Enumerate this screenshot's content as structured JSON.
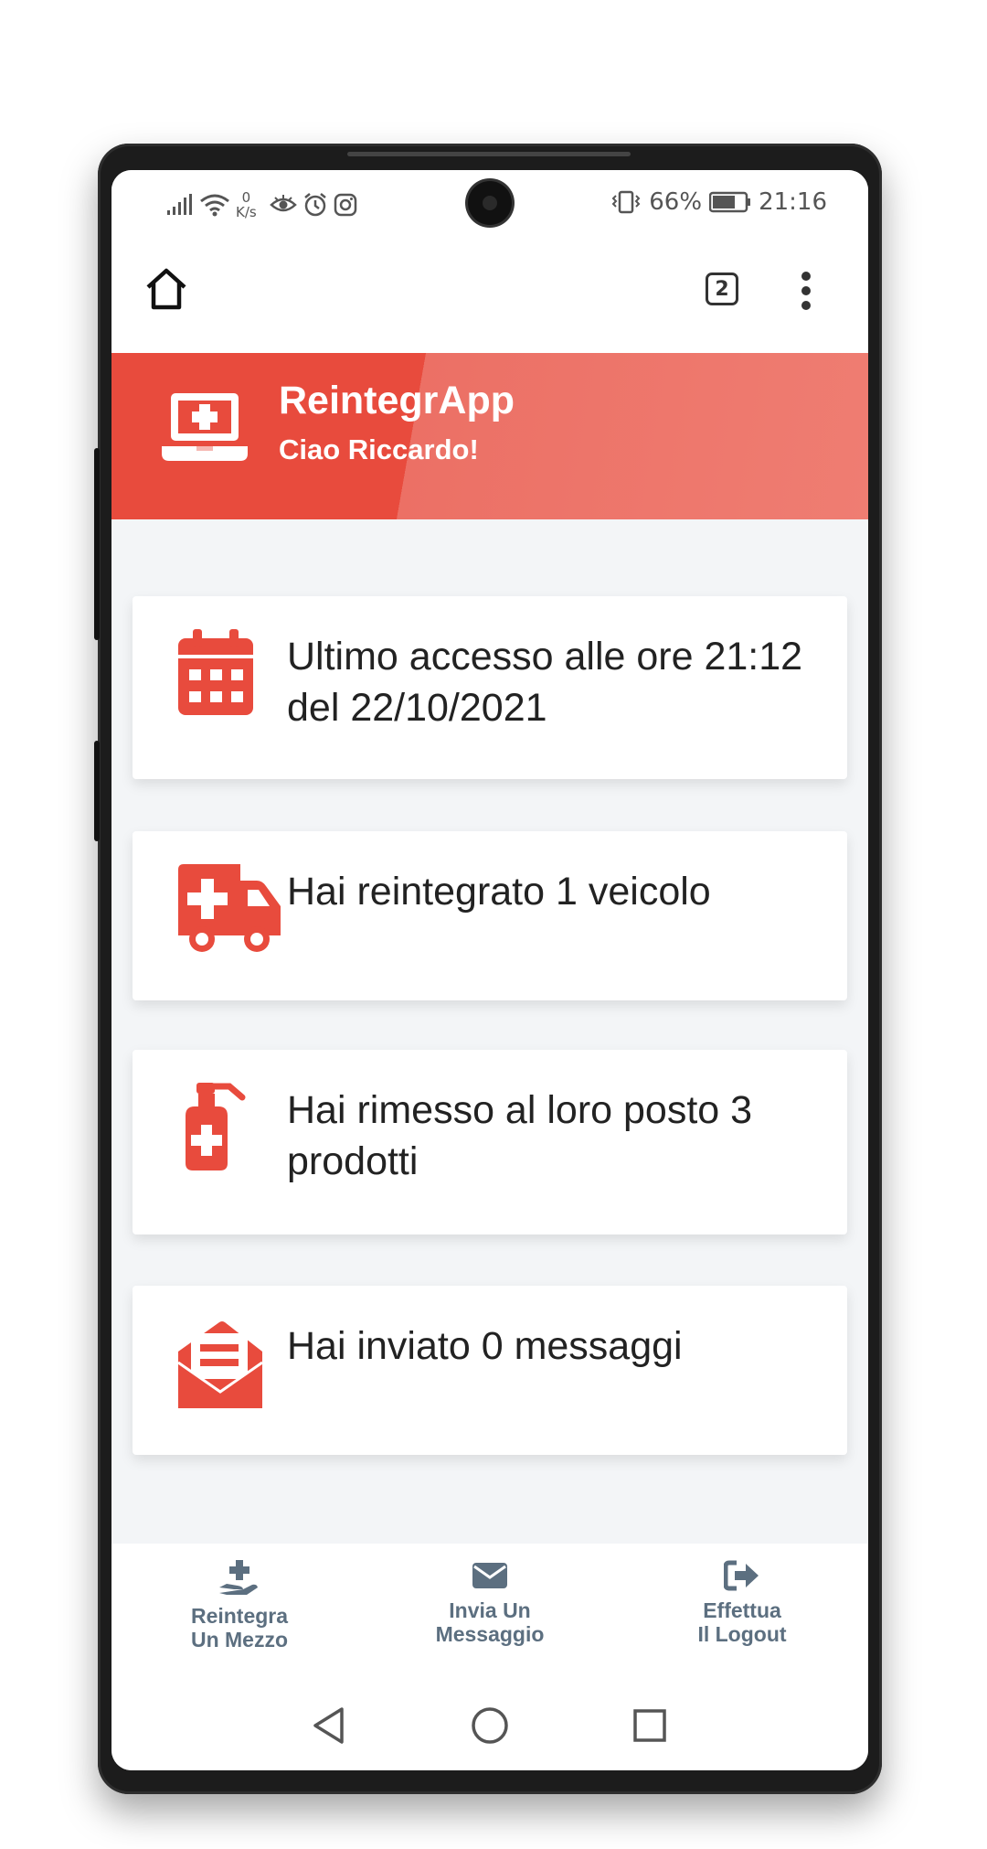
{
  "status_bar": {
    "net_speed_value": "0",
    "net_speed_unit": "K/s",
    "battery": "66%",
    "time": "21:16"
  },
  "browser_toolbar": {
    "tab_count": "2"
  },
  "header": {
    "app_title": "ReintegrApp",
    "greeting": "Ciao Riccardo!"
  },
  "cards": [
    {
      "icon": "calendar-icon",
      "text": "Ultimo accesso alle ore 21:12 del 22/10/2021"
    },
    {
      "icon": "ambulance-icon",
      "text": "Hai reintegrato 1 veicolo"
    },
    {
      "icon": "sanitizer-icon",
      "text": "Hai rimesso al loro posto 3 prodotti"
    },
    {
      "icon": "envelope-open-icon",
      "text": "Hai inviato 0 messaggi"
    }
  ],
  "bottom_nav": [
    {
      "icon": "hand-medical-icon",
      "label": "Reintegra\nUn Mezzo"
    },
    {
      "icon": "envelope-icon",
      "label": "Invia Un\nMessaggio"
    },
    {
      "icon": "sign-out-icon",
      "label": "Effettua\nIl Logout"
    }
  ],
  "colors": {
    "accent": "#e84b3d",
    "nav_text": "#5c6f80"
  }
}
